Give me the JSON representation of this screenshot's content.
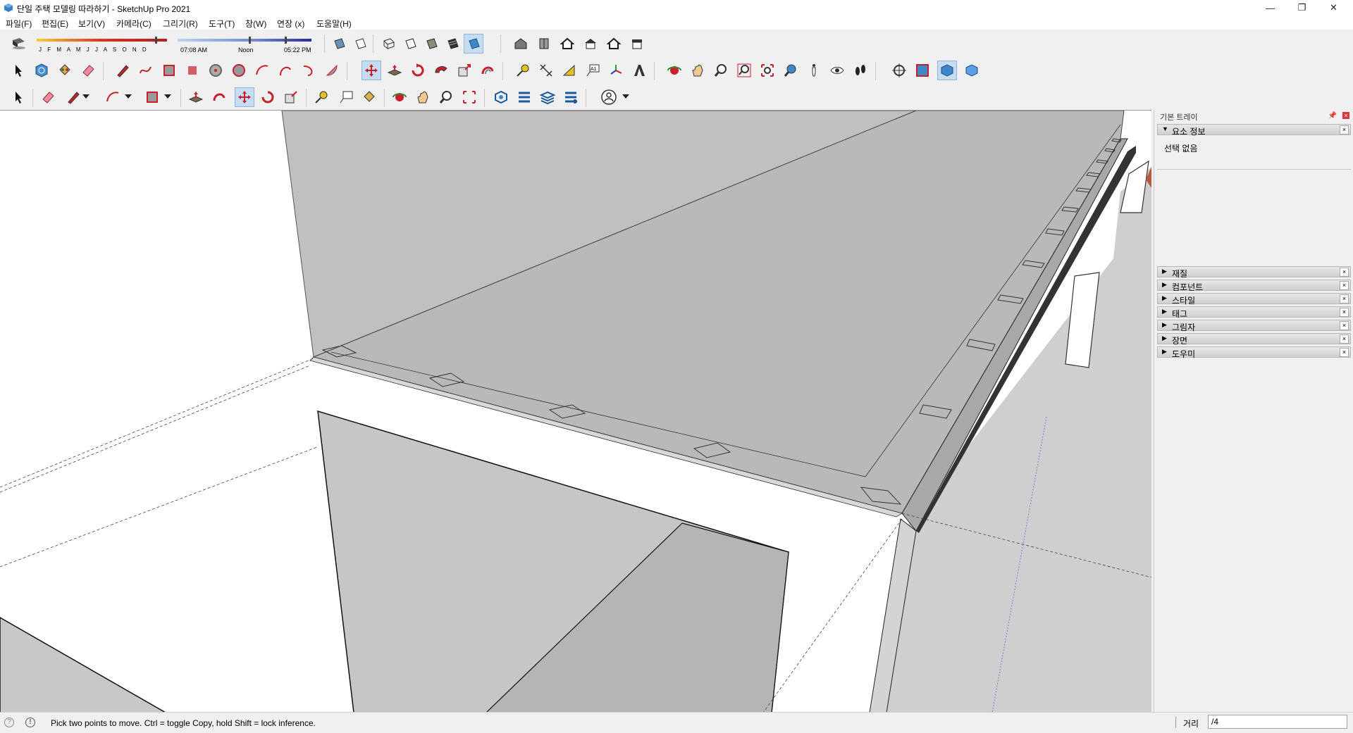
{
  "window": {
    "title": "단일 주택 모델링 따라하기 - SketchUp Pro 2021",
    "minimize": "—",
    "restore": "❐",
    "close": "✕"
  },
  "menu": [
    "파일(F)",
    "편집(E)",
    "보기(V)",
    "카메라(C)",
    "그리기(R)",
    "도구(T)",
    "창(W)",
    "연장 (x)",
    "도움말(H)"
  ],
  "shadows": {
    "months": "J F M A M J J A S O N D",
    "time_start": "07:08 AM",
    "time_mid": "Noon",
    "time_end": "05:22 PM"
  },
  "tray": {
    "title": "기본 트레이",
    "panels": {
      "entity_info": "요소 정보",
      "materials": "재질",
      "components": "컴포넌트",
      "styles": "스타일",
      "tags": "태그",
      "shadows": "그림자",
      "scenes": "장면",
      "instructor": "도우미"
    },
    "entity_info_text": "선택 없음"
  },
  "status": {
    "message": "Pick two points to move.  Ctrl = toggle Copy, hold Shift = lock inference.",
    "measurement_label": "거리",
    "measurement_value": "/4"
  },
  "colors": {
    "accent_red": "#c8202a",
    "active_tool": "#c5dcf2",
    "face_gray": "#b8b8b8"
  }
}
